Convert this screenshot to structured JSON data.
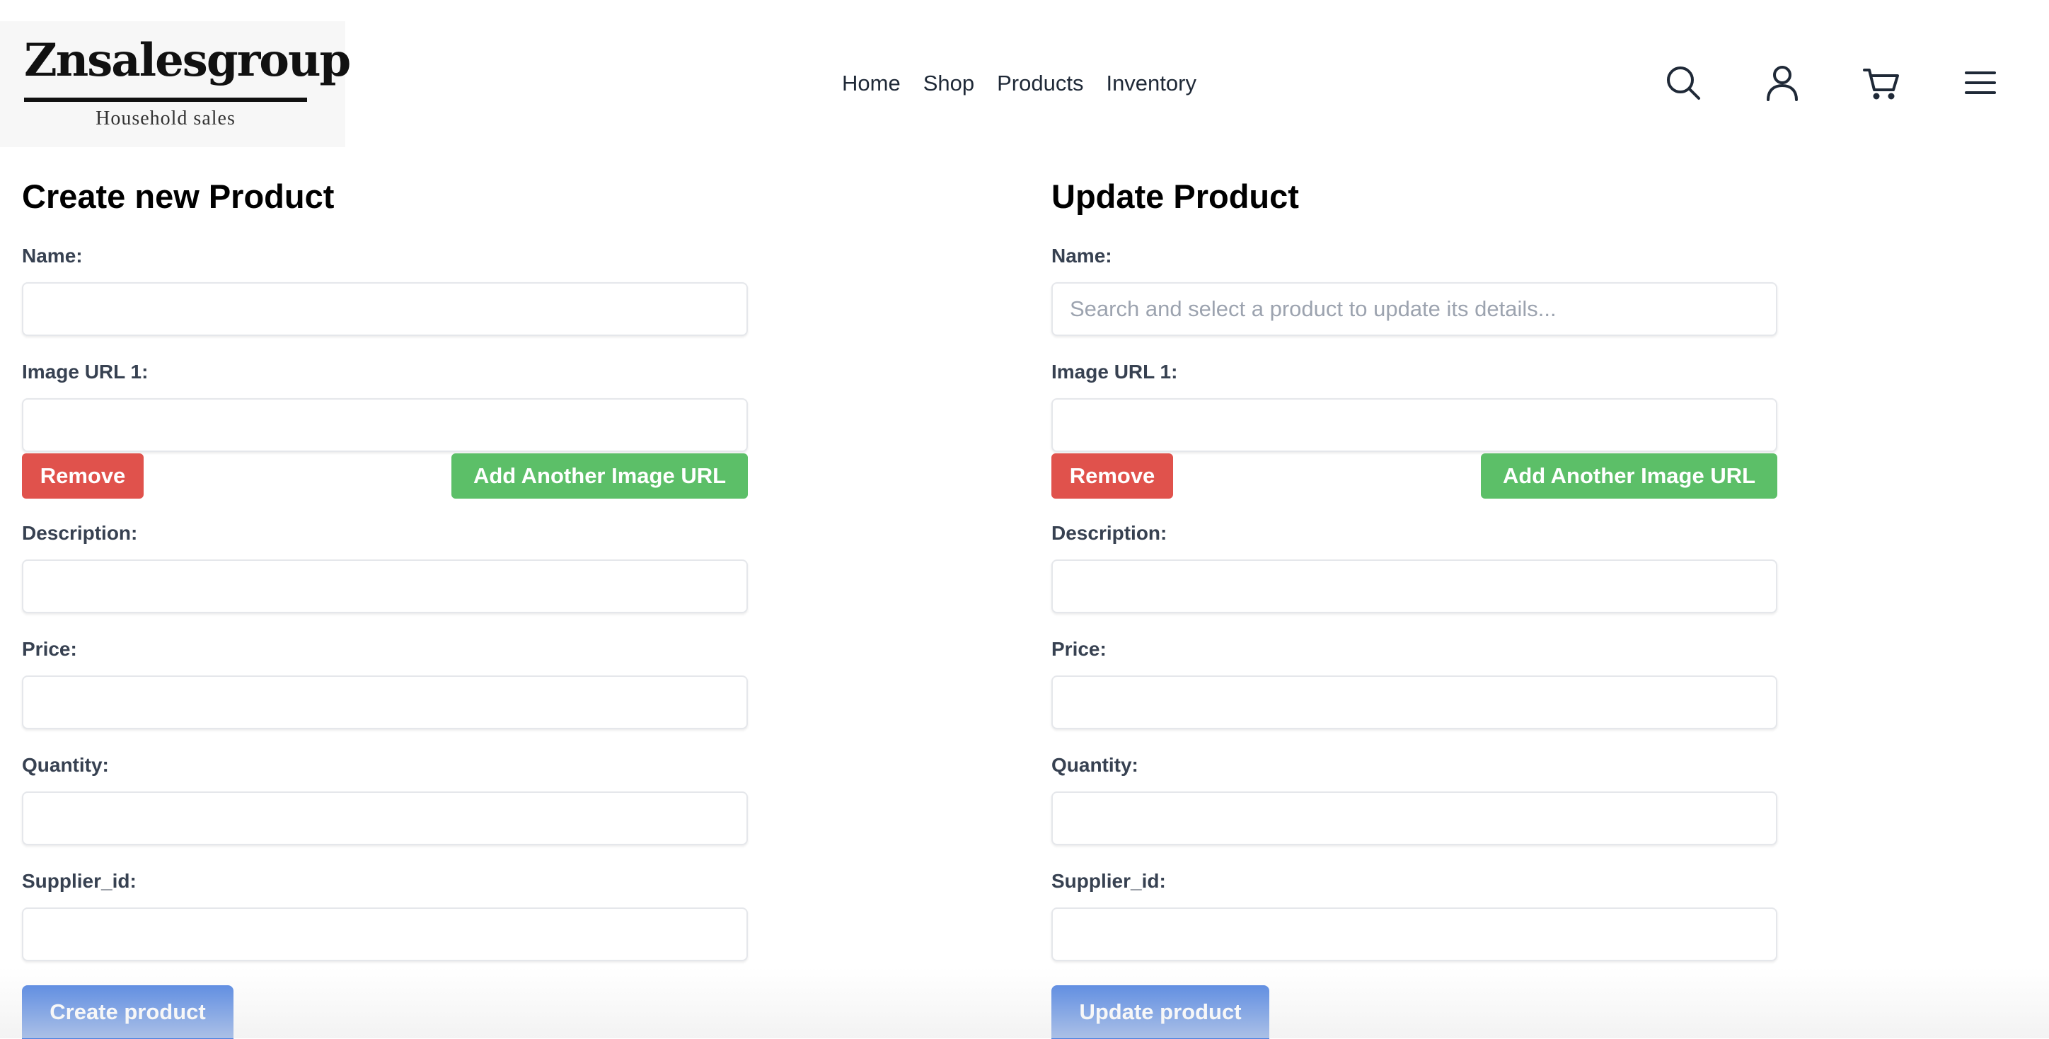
{
  "brand": {
    "name": "Znsalesgroup",
    "tagline": "Household sales"
  },
  "nav": {
    "items": [
      {
        "label": "Home"
      },
      {
        "label": "Shop"
      },
      {
        "label": "Products"
      },
      {
        "label": "Inventory"
      }
    ]
  },
  "header_icons": [
    "search-icon",
    "user-icon",
    "cart-icon",
    "menu-icon"
  ],
  "create_form": {
    "title": "Create new Product",
    "name_label": "Name:",
    "name_value": "",
    "image_url_label": "Image URL 1:",
    "image_url_value": "",
    "remove_label": "Remove",
    "add_image_label": "Add Another Image URL",
    "description_label": "Description:",
    "price_label": "Price:",
    "quantity_label": "Quantity:",
    "supplier_label": "Supplier_id:",
    "submit_label": "Create product"
  },
  "update_form": {
    "title": "Update Product",
    "name_label": "Name:",
    "name_placeholder": "Search and select a product to update its details...",
    "image_url_label": "Image URL 1:",
    "remove_label": "Remove",
    "add_image_label": "Add Another Image URL",
    "description_label": "Description:",
    "price_label": "Price:",
    "quantity_label": "Quantity:",
    "supplier_label": "Supplier_id:",
    "submit_label": "Update product"
  },
  "colors": {
    "remove_button": "#e0524c",
    "add_button": "#5cbf68",
    "submit_button": "#4a7fe0",
    "logo_background": "#f7f7f7"
  }
}
